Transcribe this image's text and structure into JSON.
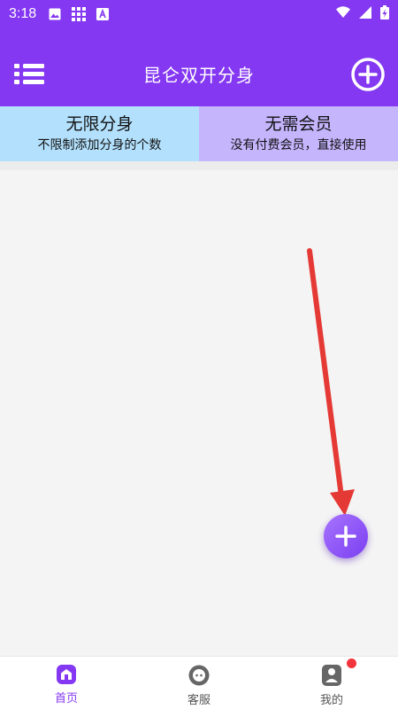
{
  "status_bar": {
    "time": "3:18",
    "icons": [
      "image-icon",
      "grid-icon",
      "text-a-icon"
    ],
    "right_icons": [
      "wifi-icon",
      "signal-icon",
      "battery-charging-icon"
    ]
  },
  "app_bar": {
    "title": "昆仑双开分身",
    "menu_icon": "list-menu-icon",
    "add_icon": "add-circle-icon"
  },
  "features": [
    {
      "title": "无限分身",
      "subtitle": "不限制添加分身的个数"
    },
    {
      "title": "无需会员",
      "subtitle": "没有付费会员，直接使用"
    }
  ],
  "fab": {
    "icon": "plus-icon"
  },
  "bottom_nav": [
    {
      "label": "首页",
      "icon": "home-icon",
      "active": true
    },
    {
      "label": "客服",
      "icon": "chat-icon",
      "active": false
    },
    {
      "label": "我的",
      "icon": "profile-icon",
      "active": false,
      "badge": true
    }
  ],
  "colors": {
    "primary": "#8438f2",
    "feature_left_bg": "#b3e1fd",
    "feature_right_bg": "#c4b5fd",
    "arrow": "#e53935",
    "badge": "#f2353c"
  }
}
